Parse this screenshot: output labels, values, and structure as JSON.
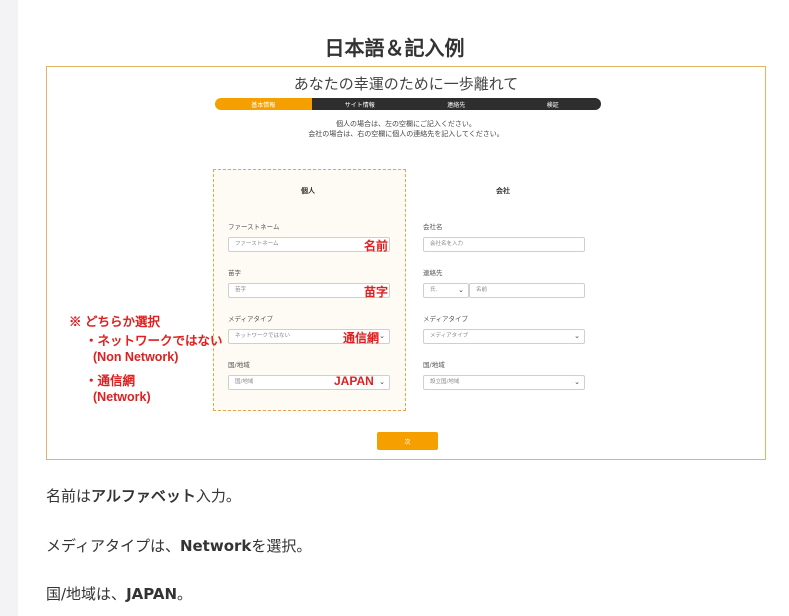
{
  "title": "日本語＆記入例",
  "screenshot": {
    "form_title": "あなたの幸運のために一歩離れて",
    "steps": [
      {
        "label": "基本情報",
        "active": true
      },
      {
        "label": "サイト情報",
        "active": false
      },
      {
        "label": "連絡先",
        "active": false
      },
      {
        "label": "検証",
        "active": false
      }
    ],
    "intro_line1": "個人の場合は、左の空欄にご記入ください。",
    "intro_line2": "会社の場合は、右の空欄に個人の連絡先を記入してください。",
    "personal": {
      "heading": "個人",
      "first_name_label": "ファーストネーム",
      "first_name_placeholder": "ファーストネーム",
      "surname_label": "苗字",
      "surname_placeholder": "苗字",
      "media_type_label": "メディアタイプ",
      "media_type_value": "ネットワークではない",
      "country_label": "国/地域",
      "country_value": "国/地域"
    },
    "company": {
      "heading": "会社",
      "company_name_label": "会社名",
      "company_name_placeholder": "会社名を入力",
      "contact_label": "連絡先",
      "title_select_value": "氏.",
      "name_placeholder": "名前",
      "media_type_label": "メディアタイプ",
      "media_type_value": "メディアタイプ",
      "country_label": "国/地域",
      "country_value": "設立国/地域"
    },
    "annotations": {
      "name": "名前",
      "surname": "苗字",
      "network": "通信網",
      "japan": "JAPAN"
    },
    "side_note": [
      "※ どちらか選択",
      "・ネットワークではない",
      "(Non Network)",
      "・通信網",
      "(Network)"
    ],
    "submit_label": "次"
  },
  "paragraphs": {
    "p1_pre": "名前は",
    "p1_bold": "アルファベット",
    "p1_post": "入力。",
    "p2_pre": "メディアタイプは、",
    "p2_bold": "Network",
    "p2_post": "を選択。",
    "p3_pre": "国/地域は、",
    "p3_bold": "JAPAN",
    "p3_post": "。"
  },
  "colors": {
    "accent": "#f5a000",
    "annotation": "#e02020",
    "step_dark": "#2e2e2e",
    "dashed_border": "#f0a24a"
  }
}
